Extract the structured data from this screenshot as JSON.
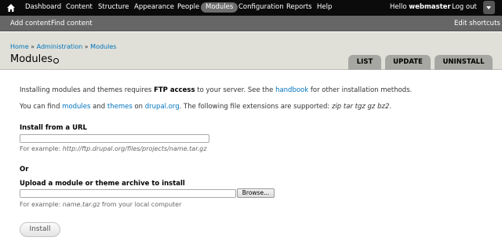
{
  "toolbar": {
    "home_icon": "home-icon",
    "items": [
      "Dashboard",
      "Content",
      "Structure",
      "Appearance",
      "People",
      "Modules",
      "Configuration",
      "Reports",
      "Help"
    ],
    "active_item": "Modules",
    "greeting": "Hello ",
    "username": "webmaster",
    "logout": "Log out"
  },
  "shortcuts": {
    "items": [
      "Add content",
      "Find content"
    ],
    "edit": "Edit shortcuts"
  },
  "breadcrumb": [
    "Home",
    "Administration",
    "Modules"
  ],
  "breadcrumb_separator": "»",
  "page_title": "Modules",
  "tabs": [
    "LIST",
    "UPDATE",
    "UNINSTALL"
  ],
  "content": {
    "line1": {
      "pre": "Installing modules and themes requires ",
      "bold": "FTP access",
      "mid": " to your server. See the ",
      "link": "handbook",
      "post": " for other installation methods."
    },
    "line2": {
      "pre": "You can find ",
      "link1": "modules",
      "and": " and ",
      "link2": "themes",
      "on": " on ",
      "link3": "drupal.org",
      "mid": ". The following file extensions are supported: ",
      "exts": "zip tar tgz gz bz2",
      "post": "."
    },
    "url_label": "Install from a URL",
    "url_value": "",
    "url_desc_pre": "For example: ",
    "url_desc_example": "http://ftp.drupal.org/files/projects/name.tar.gz",
    "or": "Or",
    "upload_label": "Upload a module or theme archive to install",
    "upload_value": "",
    "browse": "Browse...",
    "upload_desc_pre": "For example: ",
    "upload_desc_example": "name.tar.gz",
    "upload_desc_post": " from your local computer",
    "install_button": "Install"
  }
}
